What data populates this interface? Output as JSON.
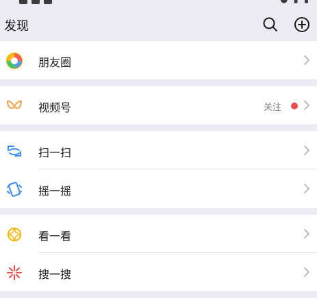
{
  "header": {
    "title": "发现",
    "search_icon": "search-icon",
    "add_icon": "add-circle-icon"
  },
  "groups": [
    {
      "items": [
        {
          "label": "朋友圈",
          "icon": "moments-aperture-icon"
        }
      ]
    },
    {
      "items": [
        {
          "label": "视频号",
          "icon": "channels-butterfly-icon",
          "status": "关注",
          "status_dot_color": "#E94C4C"
        }
      ]
    },
    {
      "items": [
        {
          "label": "扫一扫",
          "icon": "scan-icon"
        },
        {
          "label": "摇一摇",
          "icon": "shake-icon"
        }
      ]
    },
    {
      "items": [
        {
          "label": "看一看",
          "icon": "top-stories-icon"
        },
        {
          "label": "搜一搜",
          "icon": "search-sparkle-icon"
        }
      ]
    }
  ],
  "colors": {
    "background": "#ECEAF3",
    "row": "#FFFFFF",
    "badge": "#E94C4C"
  }
}
